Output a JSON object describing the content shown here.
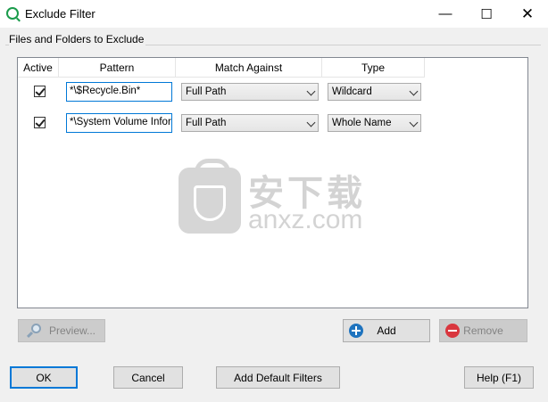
{
  "window": {
    "title": "Exclude Filter"
  },
  "group": {
    "label": "Files and Folders to Exclude"
  },
  "grid": {
    "columns": [
      "Active",
      "Pattern",
      "Match Against",
      "Type"
    ],
    "rows": [
      {
        "active": true,
        "pattern": "*\\$Recycle.Bin*",
        "match_against": "Full Path",
        "type": "Wildcard"
      },
      {
        "active": true,
        "pattern": "*\\System Volume Inform",
        "match_against": "Full Path",
        "type": "Whole Name"
      }
    ]
  },
  "watermark": {
    "cn": "安下载",
    "en": "anxz.com"
  },
  "buttons": {
    "preview": "Preview...",
    "add": "Add",
    "remove": "Remove",
    "ok": "OK",
    "cancel": "Cancel",
    "add_default": "Add Default Filters",
    "help": "Help (F1)"
  },
  "colors": {
    "accent": "#0078d7",
    "add_icon": "#1e73be",
    "remove_icon": "#d9363e",
    "app_icon": "#1a9b4b"
  }
}
